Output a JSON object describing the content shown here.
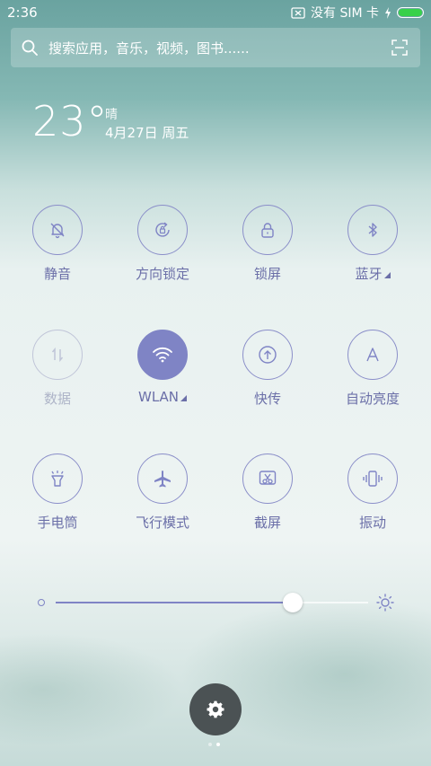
{
  "status_bar": {
    "time": "2:36",
    "sim_text": "没有 SIM 卡",
    "battery_level": 1.0
  },
  "search": {
    "placeholder": "搜索应用，音乐，视频，图书......",
    "icon": "search-icon",
    "scan_icon": "scan-icon"
  },
  "weather": {
    "temperature": "23°",
    "condition": "晴",
    "date": "4月27日 周五"
  },
  "toggles": [
    {
      "label": "静音",
      "icon": "bell-off-icon",
      "state": "off"
    },
    {
      "label": "方向锁定",
      "icon": "rotation-lock-icon",
      "state": "off"
    },
    {
      "label": "锁屏",
      "icon": "lock-icon",
      "state": "off"
    },
    {
      "label": "蓝牙",
      "icon": "bluetooth-icon",
      "state": "off",
      "has_menu": true
    },
    {
      "label": "数据",
      "icon": "data-arrows-icon",
      "state": "disabled"
    },
    {
      "label": "WLAN",
      "icon": "wifi-icon",
      "state": "on",
      "has_menu": true
    },
    {
      "label": "快传",
      "icon": "upload-icon",
      "state": "off"
    },
    {
      "label": "自动亮度",
      "icon": "auto-brightness-icon",
      "state": "off"
    },
    {
      "label": "手电筒",
      "icon": "flashlight-icon",
      "state": "off"
    },
    {
      "label": "飞行模式",
      "icon": "airplane-icon",
      "state": "off"
    },
    {
      "label": "截屏",
      "icon": "screenshot-icon",
      "state": "off"
    },
    {
      "label": "振动",
      "icon": "vibrate-icon",
      "state": "off"
    }
  ],
  "brightness": {
    "level": 0.76
  },
  "pager": {
    "pages": 2,
    "current": 2
  },
  "colors": {
    "accent": "#7f84c5",
    "label": "#6b6fa8",
    "disabled": "#aeb4c8",
    "settings_button": "#4b5254"
  }
}
